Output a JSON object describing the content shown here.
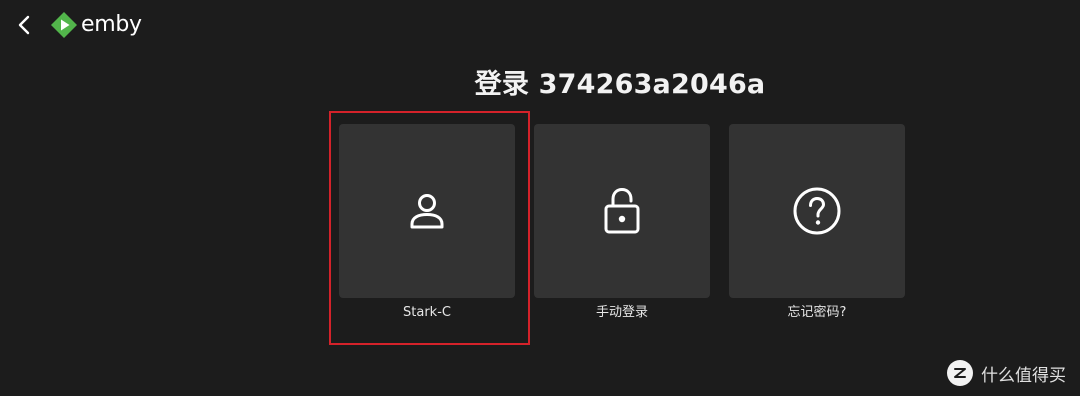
{
  "app": {
    "brand": "emby",
    "brand_color": "#52b54b"
  },
  "header": {
    "title": "登录 374263a2046a"
  },
  "tiles": [
    {
      "label": "Stark-C",
      "icon": "user-icon"
    },
    {
      "label": "手动登录",
      "icon": "unlock-icon"
    },
    {
      "label": "忘记密码?",
      "icon": "help-circle-icon"
    }
  ],
  "watermark": {
    "text": "什么值得买",
    "icon": "zhi-badge-icon"
  },
  "colors": {
    "background": "#1c1c1c",
    "tile": "#333333",
    "highlight": "#d4222a"
  }
}
